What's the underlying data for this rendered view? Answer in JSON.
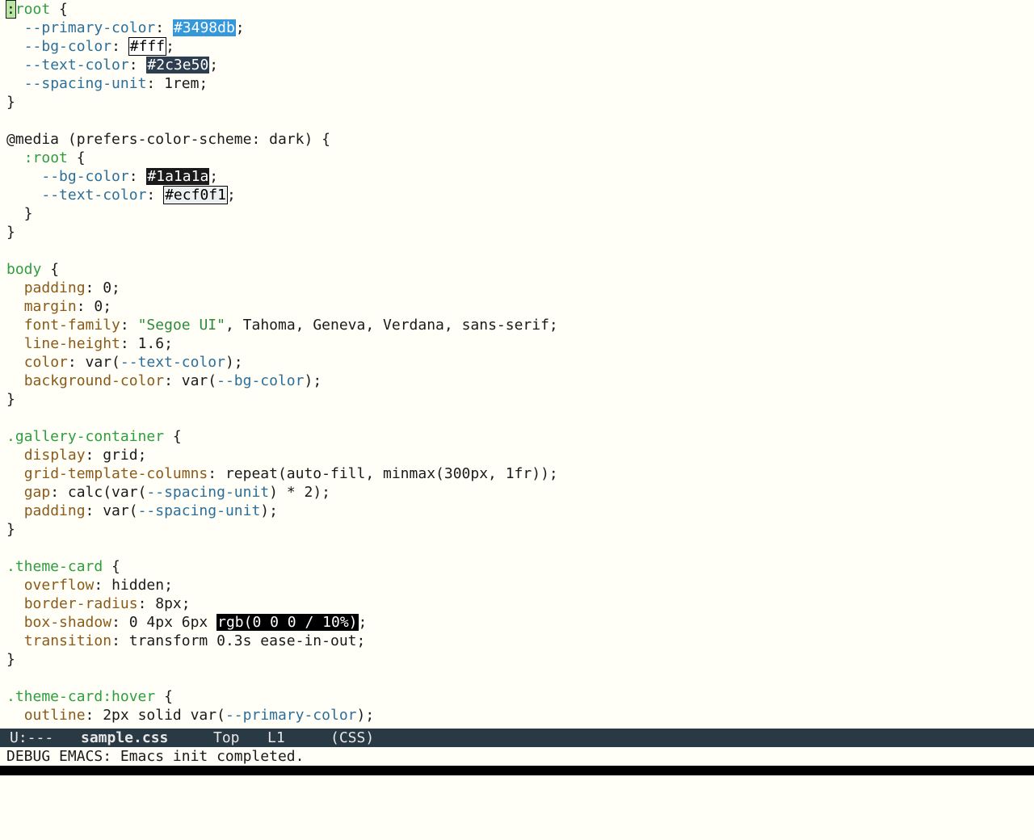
{
  "buffer": {
    "lines": [
      [
        {
          "t": ":",
          "c": "cursor"
        },
        {
          "t": "root",
          "c": "selector"
        },
        {
          "t": " {",
          "c": "punct"
        }
      ],
      [
        {
          "t": "  ",
          "c": "punct"
        },
        {
          "t": "--primary-color",
          "c": "var"
        },
        {
          "t": ": ",
          "c": "punct"
        },
        {
          "t": "#3498db",
          "c": "swatch",
          "bg": "#3498db",
          "fg": "#ffffff"
        },
        {
          "t": ";",
          "c": "punct"
        }
      ],
      [
        {
          "t": "  ",
          "c": "punct"
        },
        {
          "t": "--bg-color",
          "c": "var"
        },
        {
          "t": ": ",
          "c": "punct"
        },
        {
          "t": "#fff",
          "c": "swatch",
          "bg": "#ffffff",
          "fg": "#000000",
          "outline": true
        },
        {
          "t": ";",
          "c": "punct"
        }
      ],
      [
        {
          "t": "  ",
          "c": "punct"
        },
        {
          "t": "--text-color",
          "c": "var"
        },
        {
          "t": ": ",
          "c": "punct"
        },
        {
          "t": "#2c3e50",
          "c": "swatch",
          "bg": "#2c3e50",
          "fg": "#ffffff"
        },
        {
          "t": ";",
          "c": "punct"
        }
      ],
      [
        {
          "t": "  ",
          "c": "punct"
        },
        {
          "t": "--spacing-unit",
          "c": "var"
        },
        {
          "t": ": 1rem;",
          "c": "punct"
        }
      ],
      [
        {
          "t": "}",
          "c": "punct"
        }
      ],
      [
        {
          "t": "",
          "c": "punct"
        }
      ],
      [
        {
          "t": "@media",
          "c": "at"
        },
        {
          "t": " (prefers-color-scheme: dark) {",
          "c": "punct"
        }
      ],
      [
        {
          "t": "  ",
          "c": "punct"
        },
        {
          "t": ":root",
          "c": "selector"
        },
        {
          "t": " {",
          "c": "punct"
        }
      ],
      [
        {
          "t": "    ",
          "c": "punct"
        },
        {
          "t": "--bg-color",
          "c": "var"
        },
        {
          "t": ": ",
          "c": "punct"
        },
        {
          "t": "#1a1a1a",
          "c": "swatch",
          "bg": "#1a1a1a",
          "fg": "#ffffff"
        },
        {
          "t": ";",
          "c": "punct"
        }
      ],
      [
        {
          "t": "    ",
          "c": "punct"
        },
        {
          "t": "--text-color",
          "c": "var"
        },
        {
          "t": ": ",
          "c": "punct"
        },
        {
          "t": "#ecf0f1",
          "c": "swatch",
          "bg": "#ecf0f1",
          "fg": "#000000",
          "outline": true
        },
        {
          "t": ";",
          "c": "punct"
        }
      ],
      [
        {
          "t": "  }",
          "c": "punct"
        }
      ],
      [
        {
          "t": "}",
          "c": "punct"
        }
      ],
      [
        {
          "t": "",
          "c": "punct"
        }
      ],
      [
        {
          "t": "body",
          "c": "selector"
        },
        {
          "t": " {",
          "c": "punct"
        }
      ],
      [
        {
          "t": "  ",
          "c": "punct"
        },
        {
          "t": "padding",
          "c": "prop"
        },
        {
          "t": ": 0;",
          "c": "punct"
        }
      ],
      [
        {
          "t": "  ",
          "c": "punct"
        },
        {
          "t": "margin",
          "c": "prop"
        },
        {
          "t": ": 0;",
          "c": "punct"
        }
      ],
      [
        {
          "t": "  ",
          "c": "punct"
        },
        {
          "t": "font-family",
          "c": "prop"
        },
        {
          "t": ": ",
          "c": "punct"
        },
        {
          "t": "\"Segoe UI\"",
          "c": "string"
        },
        {
          "t": ", Tahoma, Geneva, Verdana, sans-serif;",
          "c": "punct"
        }
      ],
      [
        {
          "t": "  ",
          "c": "punct"
        },
        {
          "t": "line-height",
          "c": "prop"
        },
        {
          "t": ": 1.6;",
          "c": "punct"
        }
      ],
      [
        {
          "t": "  ",
          "c": "punct"
        },
        {
          "t": "color",
          "c": "prop"
        },
        {
          "t": ": var(",
          "c": "punct"
        },
        {
          "t": "--text-color",
          "c": "var"
        },
        {
          "t": ");",
          "c": "punct"
        }
      ],
      [
        {
          "t": "  ",
          "c": "punct"
        },
        {
          "t": "background-color",
          "c": "prop"
        },
        {
          "t": ": var(",
          "c": "punct"
        },
        {
          "t": "--bg-color",
          "c": "var"
        },
        {
          "t": ");",
          "c": "punct"
        }
      ],
      [
        {
          "t": "}",
          "c": "punct"
        }
      ],
      [
        {
          "t": "",
          "c": "punct"
        }
      ],
      [
        {
          "t": ".gallery-container",
          "c": "selector"
        },
        {
          "t": " {",
          "c": "punct"
        }
      ],
      [
        {
          "t": "  ",
          "c": "punct"
        },
        {
          "t": "display",
          "c": "prop"
        },
        {
          "t": ": grid;",
          "c": "punct"
        }
      ],
      [
        {
          "t": "  ",
          "c": "punct"
        },
        {
          "t": "grid-template-columns",
          "c": "prop"
        },
        {
          "t": ": repeat(auto-fill, minmax(300px, 1fr));",
          "c": "punct"
        }
      ],
      [
        {
          "t": "  ",
          "c": "punct"
        },
        {
          "t": "gap",
          "c": "prop"
        },
        {
          "t": ": calc(var(",
          "c": "punct"
        },
        {
          "t": "--spacing-unit",
          "c": "var"
        },
        {
          "t": ") * 2);",
          "c": "punct"
        }
      ],
      [
        {
          "t": "  ",
          "c": "punct"
        },
        {
          "t": "padding",
          "c": "prop"
        },
        {
          "t": ": var(",
          "c": "punct"
        },
        {
          "t": "--spacing-unit",
          "c": "var"
        },
        {
          "t": ");",
          "c": "punct"
        }
      ],
      [
        {
          "t": "}",
          "c": "punct"
        }
      ],
      [
        {
          "t": "",
          "c": "punct"
        }
      ],
      [
        {
          "t": ".theme-card",
          "c": "selector"
        },
        {
          "t": " {",
          "c": "punct"
        }
      ],
      [
        {
          "t": "  ",
          "c": "punct"
        },
        {
          "t": "overflow",
          "c": "prop"
        },
        {
          "t": ": hidden;",
          "c": "punct"
        }
      ],
      [
        {
          "t": "  ",
          "c": "punct"
        },
        {
          "t": "border-radius",
          "c": "prop"
        },
        {
          "t": ": 8px;",
          "c": "punct"
        }
      ],
      [
        {
          "t": "  ",
          "c": "punct"
        },
        {
          "t": "box-shadow",
          "c": "prop"
        },
        {
          "t": ": 0 4px 6px ",
          "c": "punct"
        },
        {
          "t": "rgb(0 0 0 / 10%)",
          "c": "swatch",
          "bg": "#000000",
          "fg": "#ffffff"
        },
        {
          "t": ";",
          "c": "punct"
        }
      ],
      [
        {
          "t": "  ",
          "c": "punct"
        },
        {
          "t": "transition",
          "c": "prop"
        },
        {
          "t": ": transform 0.3s ease-in-out;",
          "c": "punct"
        }
      ],
      [
        {
          "t": "}",
          "c": "punct"
        }
      ],
      [
        {
          "t": "",
          "c": "punct"
        }
      ],
      [
        {
          "t": ".theme-card:hover",
          "c": "selector"
        },
        {
          "t": " {",
          "c": "punct"
        }
      ],
      [
        {
          "t": "  ",
          "c": "punct"
        },
        {
          "t": "outline",
          "c": "prop"
        },
        {
          "t": ": 2px solid var(",
          "c": "punct"
        },
        {
          "t": "--primary-color",
          "c": "var"
        },
        {
          "t": ");",
          "c": "punct"
        }
      ]
    ]
  },
  "modeline": {
    "status": "U:---",
    "buffer_name": "sample.css",
    "position": "Top",
    "line": "L1",
    "mode": "(CSS)"
  },
  "echo_area": {
    "message": "DEBUG EMACS: Emacs init completed."
  },
  "colors": {
    "background": "#fffff8",
    "modeline_bg": "#2a3a44",
    "selector": "#2e9e3e",
    "property": "#8a5a1a",
    "variable": "#2b6f9a"
  }
}
